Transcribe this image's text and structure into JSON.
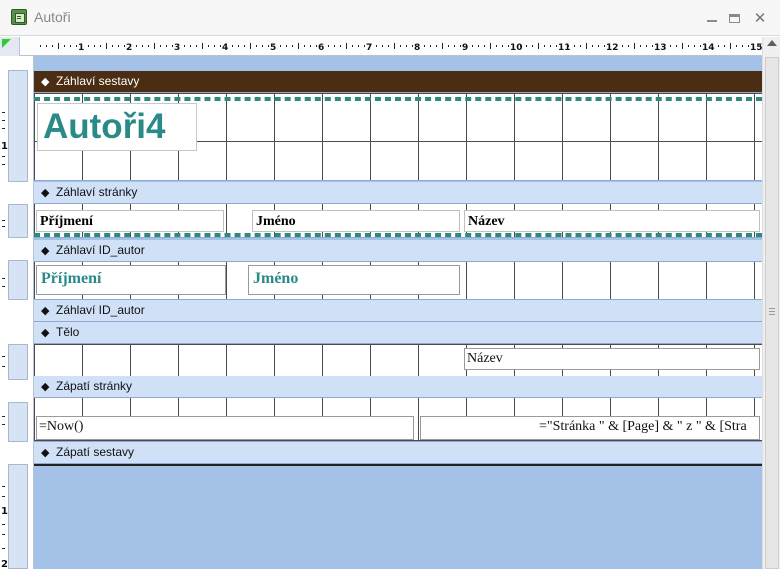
{
  "window": {
    "title": "Autoři",
    "app_icon": "access-report-icon",
    "controls": [
      "minimize-icon",
      "maximize-icon",
      "close-icon"
    ]
  },
  "ruler": {
    "numbers": [
      "1",
      "2",
      "3",
      "4",
      "5",
      "6",
      "7",
      "8",
      "9",
      "10",
      "11",
      "12",
      "13",
      "14",
      "15"
    ],
    "vertical_numbers": [
      "1",
      "1",
      "2"
    ]
  },
  "sections": {
    "report_header": "Záhlaví sestavy",
    "page_header": "Záhlaví stránky",
    "group_header_1": "Záhlaví ID_autor",
    "group_header_2": "Záhlaví ID_autor",
    "detail": "Tělo",
    "page_footer": "Zápatí stránky",
    "report_footer": "Zápatí sestavy"
  },
  "controls": {
    "report_title": "Autoři4",
    "page_header_labels": {
      "surname": "Příjmení",
      "first_name": "Jméno",
      "title": "Název"
    },
    "group_fields": {
      "surname": "Příjmení",
      "first_name": "Jméno"
    },
    "detail_field": "Název",
    "footer_date": "=Now()",
    "footer_page": "=\"Stránka \" & [Page] & \" z \" & [Stra"
  },
  "colors": {
    "selected_section": "#4a2d12",
    "section_bar": "#cfe0f7",
    "canvas_background": "#a4c2e8",
    "title_text": "#2a8a88",
    "dashed_border": "#2e8a7c"
  }
}
